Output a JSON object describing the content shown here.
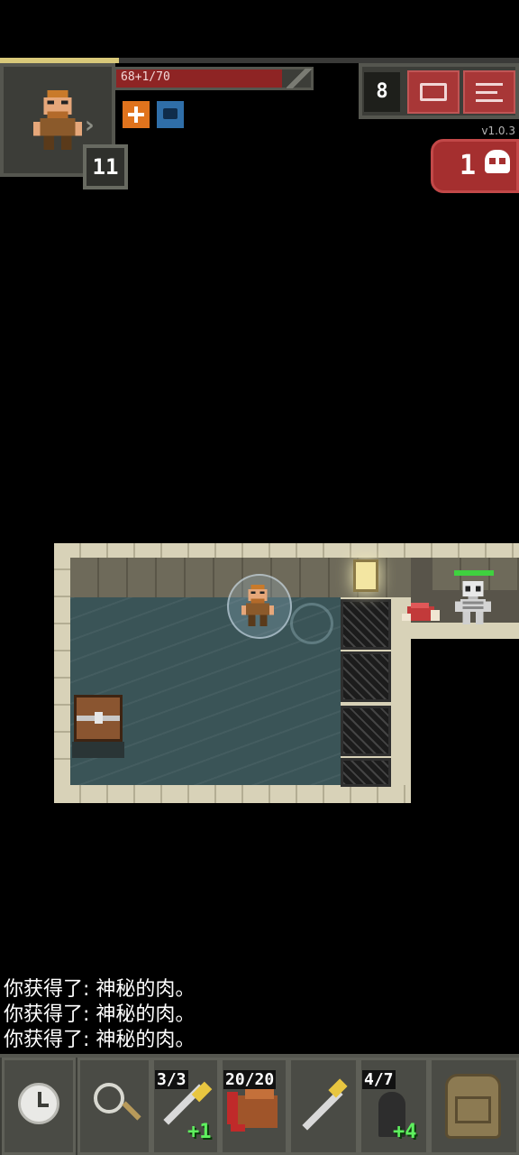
{
  "hud": {
    "hp_text": "68+1/70",
    "hp_fraction": 0.97,
    "xp_fraction": 0.23,
    "hero_level": "11",
    "depth": "8",
    "version": "v1.0.3",
    "danger_count": "1",
    "buffs": [
      "buff-orange-icon",
      "buff-blue-icon"
    ],
    "colors": {
      "hp": "#8e2424",
      "button_red": "#a83737",
      "buff_orange": "#e0731d",
      "buff_blue": "#2f6ea8"
    }
  },
  "game_log": [
    "你获得了: 神秘的肉。",
    "你获得了: 神秘的肉。",
    "你获得了: 神秘的肉。"
  ],
  "toolbar": {
    "quickslot_1": {
      "count": "3/3",
      "bonus": "+1"
    },
    "quickslot_2": {
      "count": "20/20"
    },
    "quickslot_3": {},
    "quickslot_4": {
      "count": "4/7",
      "bonus": "+4"
    }
  },
  "enemy": {
    "hp_fraction": 1.0
  }
}
